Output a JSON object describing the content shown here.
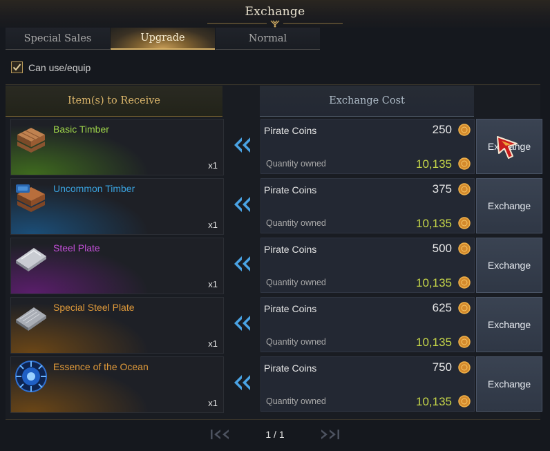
{
  "window": {
    "title": "Exchange"
  },
  "tabs": [
    {
      "label": "Special Sales",
      "active": false
    },
    {
      "label": "Upgrade",
      "active": true
    },
    {
      "label": "Normal",
      "active": false
    }
  ],
  "filter": {
    "label": "Can use/equip",
    "checked": true
  },
  "columns": {
    "receive": "Item(s) to Receive",
    "cost": "Exchange Cost"
  },
  "rows": [
    {
      "item": {
        "name": "Basic Timber",
        "qty": "x1",
        "name_color": "#9fd64a",
        "glow_color": "#3f6b1e",
        "icon": "timber-icon"
      },
      "cost": {
        "currency": "Pirate Coins",
        "price": "250",
        "owned_label": "Quantity owned",
        "owned": "10,135"
      },
      "button": "Exchange"
    },
    {
      "item": {
        "name": "Uncommon Timber",
        "qty": "x1",
        "name_color": "#3aa3e0",
        "glow_color": "#1b4e78",
        "icon": "uncommon-timber-icon"
      },
      "cost": {
        "currency": "Pirate Coins",
        "price": "375",
        "owned_label": "Quantity owned",
        "owned": "10,135"
      },
      "button": "Exchange"
    },
    {
      "item": {
        "name": "Steel Plate",
        "qty": "x1",
        "name_color": "#c44fd9",
        "glow_color": "#5a1e6b",
        "icon": "steel-plate-icon"
      },
      "cost": {
        "currency": "Pirate Coins",
        "price": "500",
        "owned_label": "Quantity owned",
        "owned": "10,135"
      },
      "button": "Exchange"
    },
    {
      "item": {
        "name": "Special Steel Plate",
        "qty": "x1",
        "name_color": "#e09a3a",
        "glow_color": "#6b4616",
        "icon": "special-steel-plate-icon"
      },
      "cost": {
        "currency": "Pirate Coins",
        "price": "625",
        "owned_label": "Quantity owned",
        "owned": "10,135"
      },
      "button": "Exchange"
    },
    {
      "item": {
        "name": "Essence of the Ocean",
        "qty": "x1",
        "name_color": "#e09a3a",
        "glow_color": "#6b4616",
        "icon": "ocean-essence-icon"
      },
      "cost": {
        "currency": "Pirate Coins",
        "price": "750",
        "owned_label": "Quantity owned",
        "owned": "10,135"
      },
      "button": "Exchange"
    }
  ],
  "pagination": {
    "label": "1 / 1"
  },
  "colors": {
    "accent_gold": "#d9b46a",
    "owned_value": "#c6d649",
    "button_bg": "#3a4352"
  }
}
